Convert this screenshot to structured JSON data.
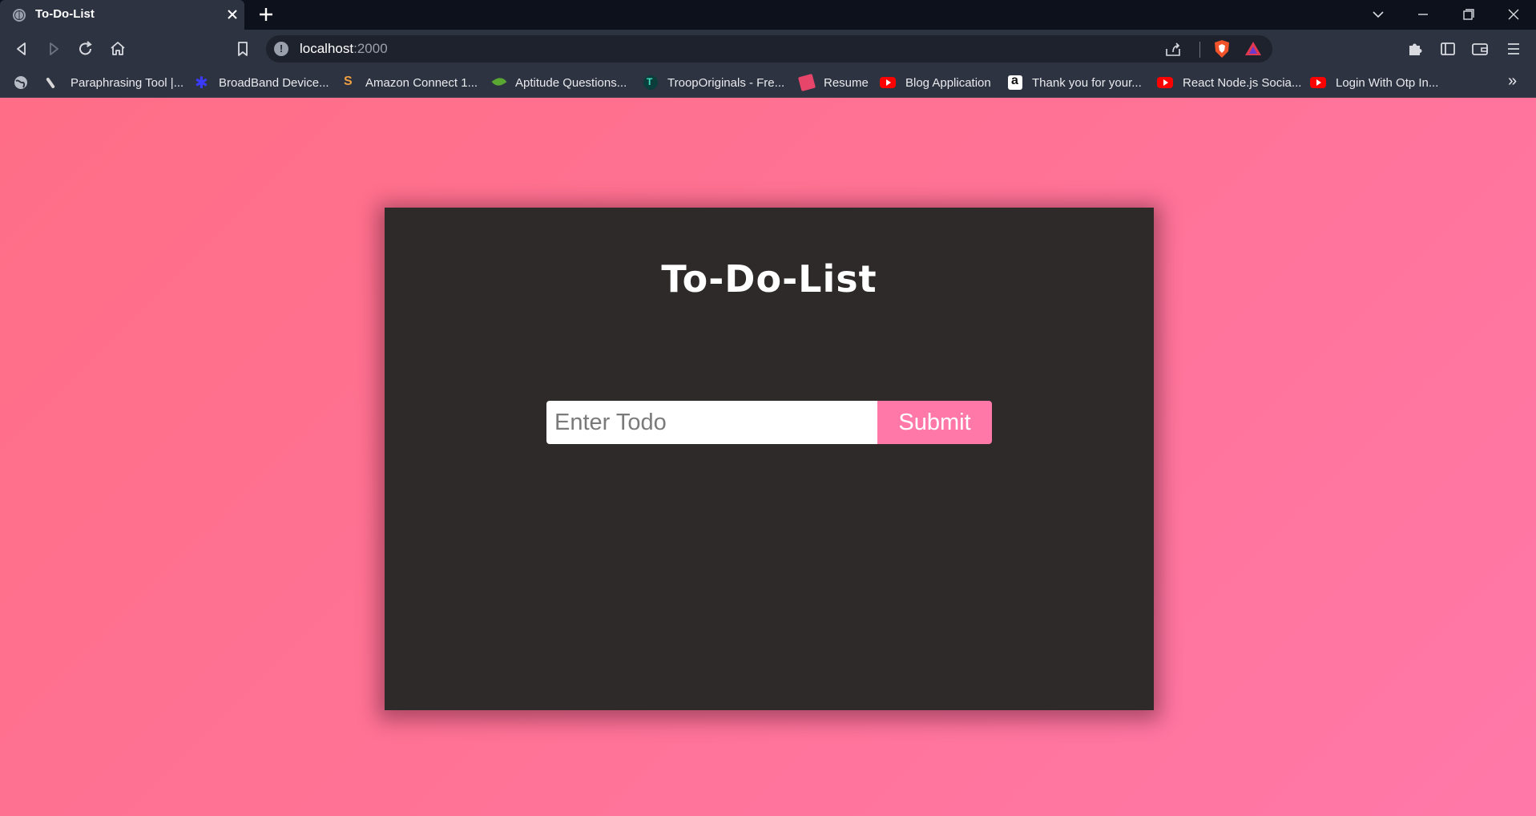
{
  "browser": {
    "tab": {
      "title": "To-Do-List"
    },
    "address_bar": {
      "host": "localhost",
      "port": ":2000"
    },
    "bookmarks": [
      {
        "label": "Paraphrasing Tool |...",
        "icon": "feather-icon"
      },
      {
        "label": "BroadBand Device...",
        "icon": "spider-icon"
      },
      {
        "label": "Amazon Connect 1...",
        "icon": "amazon-connect-icon"
      },
      {
        "label": "Aptitude Questions...",
        "icon": "leaf-icon"
      },
      {
        "label": "TroopOriginals - Fre...",
        "icon": "troop-icon"
      },
      {
        "label": "Resume",
        "icon": "resume-icon"
      },
      {
        "label": "Blog Application",
        "icon": "youtube-icon"
      },
      {
        "label": "Thank you for your...",
        "icon": "amazon-icon"
      },
      {
        "label": "React Node.js Socia...",
        "icon": "youtube-icon"
      },
      {
        "label": "Login With Otp In...",
        "icon": "youtube-icon"
      }
    ],
    "bookmarks_more": "»"
  },
  "app": {
    "title": "To-Do-List",
    "input": {
      "placeholder": "Enter Todo",
      "value": ""
    },
    "submit_label": "Submit"
  },
  "colors": {
    "page_background": "#ff7398",
    "card_background": "#2e2a29",
    "accent": "#ff78a8",
    "browser_chrome": "#2d3340"
  }
}
